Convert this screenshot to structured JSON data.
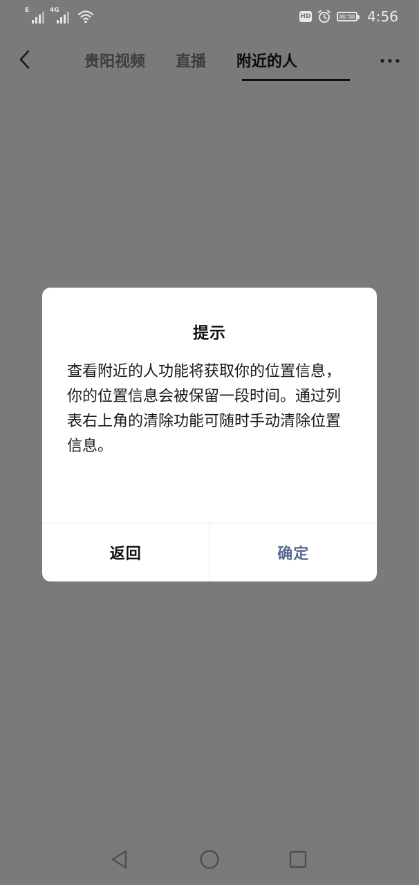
{
  "status_bar": {
    "sim1_label": "E",
    "sim2_label": "4G",
    "hd_label": "HD",
    "time": "4:56",
    "icons": [
      "signal-icon",
      "wifi-icon",
      "hd-icon",
      "alarm-icon",
      "battery-charging-icon"
    ]
  },
  "nav": {
    "back_icon": "chevron-left-icon",
    "tabs": [
      {
        "label": "贵阳视频",
        "active": false
      },
      {
        "label": "直播",
        "active": false
      },
      {
        "label": "附近的人",
        "active": true
      }
    ],
    "more_icon": "more-dots-icon"
  },
  "dialog": {
    "title": "提示",
    "message": "查看附近的人功能将获取你的位置信息，你的位置信息会被保留一段时间。通过列表右上角的清除功能可随时手动清除位置信息。",
    "cancel_label": "返回",
    "confirm_label": "确定"
  },
  "colors": {
    "overlay_bg": "#7a7a7a",
    "dialog_bg": "#ffffff",
    "confirm_text": "#576b95"
  },
  "system_nav": {
    "icons": [
      "triangle-back-icon",
      "circle-home-icon",
      "square-recent-icon"
    ]
  }
}
